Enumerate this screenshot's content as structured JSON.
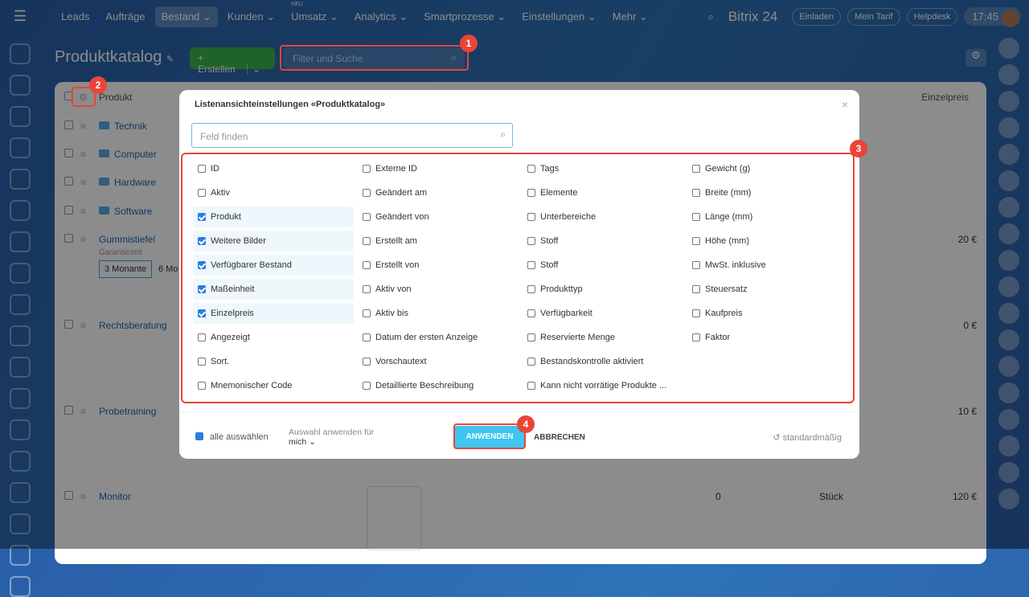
{
  "topbar": {
    "nav": [
      "Leads",
      "Aufträge",
      "Bestand",
      "Kunden",
      "Umsatz",
      "Analytics",
      "Smartprozesse",
      "Einstellungen",
      "Mehr"
    ],
    "new_badge": "NEU",
    "brand": "Bitrix 24",
    "invite": "Einladen",
    "tariff": "Mein Tarif",
    "helpdesk": "Helpdesk",
    "time": "17:45"
  },
  "page": {
    "title": "Produktkatalog",
    "create": "+ Erstellen",
    "filter_placeholder": "Filter und Suche"
  },
  "table": {
    "col_product": "Produkt",
    "col_price": "Einzelpreis",
    "rows": [
      {
        "name": "Technik"
      },
      {
        "name": "Computer"
      },
      {
        "name": "Hardware"
      },
      {
        "name": "Software"
      },
      {
        "name": "Gummistiefel",
        "price": "20 €",
        "sub_label": "Garantiezeit",
        "opt1": "3 Monante",
        "opt2": "6 Mo"
      },
      {
        "name": "Rechtsberatung",
        "price": "0 €"
      },
      {
        "name": "Probetraining",
        "price": "10 €"
      },
      {
        "name": "Monitor",
        "qty": "0",
        "unit": "Stück",
        "price": "120 €"
      }
    ]
  },
  "modal": {
    "title": "Listenansichteinstellungen «Produktkatalog»",
    "find_placeholder": "Feld finden",
    "columns": [
      [
        {
          "l": "ID"
        },
        {
          "l": "Aktiv"
        },
        {
          "l": "Produkt",
          "on": true
        },
        {
          "l": "Weitere Bilder",
          "on": true
        },
        {
          "l": "Verfügbarer Bestand",
          "on": true
        },
        {
          "l": "Maßeinheit",
          "on": true
        },
        {
          "l": "Einzelpreis",
          "on": true
        },
        {
          "l": "Angezeigt"
        },
        {
          "l": "Sort."
        },
        {
          "l": "Mnemonischer Code"
        }
      ],
      [
        {
          "l": "Externe ID"
        },
        {
          "l": "Geändert am"
        },
        {
          "l": "Geändert von"
        },
        {
          "l": "Erstellt am"
        },
        {
          "l": "Erstellt von"
        },
        {
          "l": "Aktiv von"
        },
        {
          "l": "Aktiv bis"
        },
        {
          "l": "Datum der ersten Anzeige"
        },
        {
          "l": "Vorschautext"
        },
        {
          "l": "Detaillierte Beschreibung"
        }
      ],
      [
        {
          "l": "Tags"
        },
        {
          "l": "Elemente"
        },
        {
          "l": "Unterbereiche"
        },
        {
          "l": "Stoff"
        },
        {
          "l": "Stoff"
        },
        {
          "l": "Produkttyp"
        },
        {
          "l": "Verfügbarkeit"
        },
        {
          "l": "Reservierte Menge"
        },
        {
          "l": "Bestandskontrolle aktiviert"
        },
        {
          "l": "Kann nicht vorrätige Produkte ..."
        }
      ],
      [
        {
          "l": "Gewicht (g)"
        },
        {
          "l": "Breite (mm)"
        },
        {
          "l": "Länge (mm)"
        },
        {
          "l": "Höhe (mm)"
        },
        {
          "l": "MwSt. inklusive"
        },
        {
          "l": "Steuersatz"
        },
        {
          "l": "Kaufpreis"
        },
        {
          "l": "Faktor"
        }
      ]
    ],
    "select_all": "alle auswählen",
    "apply_for": "Auswahl anwenden für",
    "apply_for_value": "mich ⌄",
    "apply": "ANWENDEN",
    "cancel": "ABBRECHEN",
    "default": "standardmäßig"
  },
  "badges": [
    "1",
    "2",
    "3",
    "4"
  ],
  "colors": {
    "accent": "#3ec5f0",
    "highlight": "#e9443a",
    "create": "#3bb54a"
  }
}
